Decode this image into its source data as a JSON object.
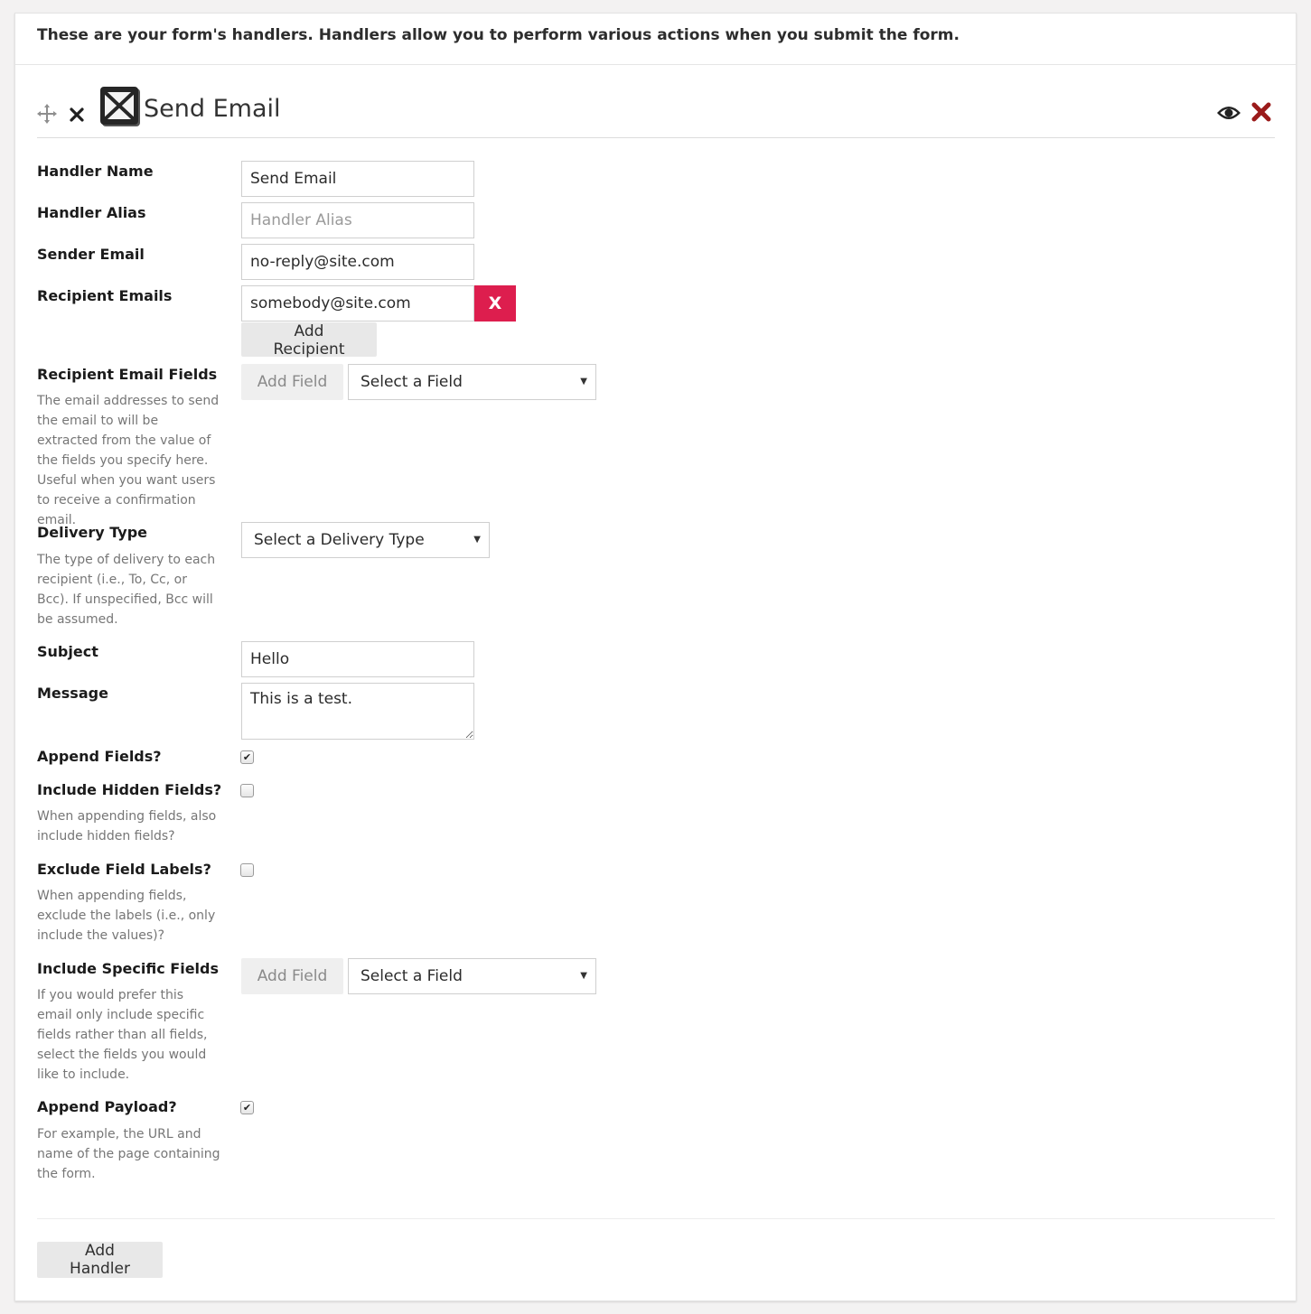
{
  "intro": "These are your form's handlers. Handlers allow you to perform various actions when you submit the form.",
  "handler": {
    "title": "Send Email",
    "icons": {
      "move": "move-icon",
      "collapse": "close-icon",
      "type": "mail-icon",
      "toggle": "eye-icon",
      "delete": "delete-icon"
    },
    "delete_color": "#9b1b1b"
  },
  "fields": {
    "handler_name": {
      "label": "Handler Name",
      "value": "Send Email"
    },
    "handler_alias": {
      "label": "Handler Alias",
      "placeholder": "Handler Alias"
    },
    "sender_email": {
      "label": "Sender Email",
      "value": "no-reply@site.com"
    },
    "recipient_emails": {
      "label": "Recipient Emails",
      "value": "somebody@site.com",
      "remove_label": "X",
      "add_label": "Add Recipient"
    },
    "recipient_email_fields": {
      "label": "Recipient Email Fields",
      "hint": "The email addresses to send the email to will be extracted from the value of the fields you specify here. Useful when you want users to receive a confirmation email.",
      "add_label": "Add Field",
      "select_value": "Select a Field"
    },
    "delivery_type": {
      "label": "Delivery Type",
      "hint": "The type of delivery to each recipient (i.e., To, Cc, or Bcc). If unspecified, Bcc will be assumed.",
      "select_value": "Select a Delivery Type"
    },
    "subject": {
      "label": "Subject",
      "value": "Hello"
    },
    "message": {
      "label": "Message",
      "value": "This is a test."
    },
    "append_fields": {
      "label": "Append Fields?",
      "checked": true
    },
    "include_hidden_fields": {
      "label": "Include Hidden Fields?",
      "hint": "When appending fields, also include hidden fields?",
      "checked": false
    },
    "exclude_field_labels": {
      "label": "Exclude Field Labels?",
      "hint": "When appending fields, exclude the labels (i.e., only include the values)?",
      "checked": false
    },
    "include_specific_fields": {
      "label": "Include Specific Fields",
      "hint": "If you would prefer this email only include specific fields rather than all fields, select the fields you would like to include.",
      "add_label": "Add Field",
      "select_value": "Select a Field"
    },
    "append_payload": {
      "label": "Append Payload?",
      "hint": "For example, the URL and name of the page containing the form.",
      "checked": true
    }
  },
  "add_handler_label": "Add Handler",
  "colors": {
    "accent_remove": "#dd1e4e",
    "page_bg": "#f3f2f2"
  }
}
